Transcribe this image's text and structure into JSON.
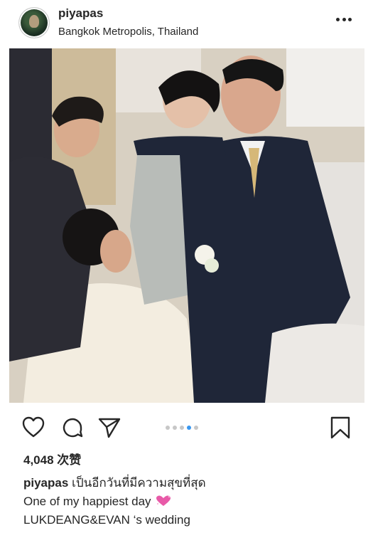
{
  "post": {
    "username": "piyapas",
    "location": "Bangkok Metropolis, Thailand",
    "likes": "4,048 次赞",
    "caption": {
      "username": "piyapas",
      "line1": "เป็นอีกวันที่มีความสุขที่สุด",
      "line2": "One of my happiest day",
      "line3": "LUKDEANG&EVAN ‘s wedding"
    },
    "carousel": {
      "total": 5,
      "active_index": 3
    }
  },
  "icons": {
    "more": "more-horizontal-icon",
    "like": "heart-icon",
    "comment": "comment-icon",
    "share": "send-icon",
    "save": "bookmark-icon",
    "caption_emoji": "sparkling-heart-icon"
  },
  "colors": {
    "text": "#262626",
    "carousel_active": "#3897f0",
    "carousel_inactive": "#c7c7c7",
    "emoji": "#e85aa8"
  }
}
